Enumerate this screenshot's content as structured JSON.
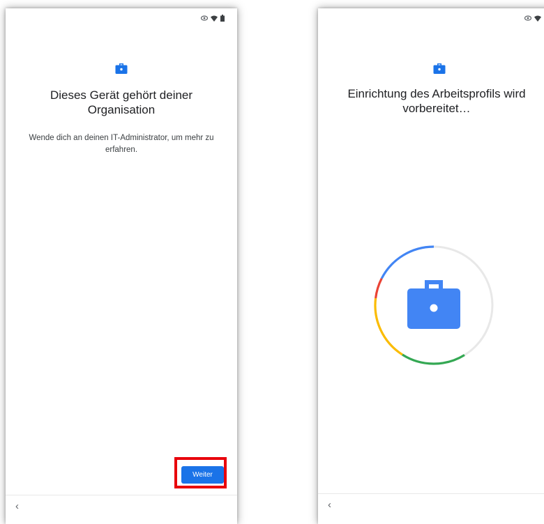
{
  "screens": [
    {
      "title": "Dieses Gerät gehört deiner Organisation",
      "description": "Wende dich an deinen IT-Administrator, um mehr zu erfahren.",
      "continue_button": "Weiter",
      "back_glyph": "‹",
      "icons": [
        "briefcase-icon",
        "eye-icon",
        "wifi-icon",
        "battery-icon"
      ]
    },
    {
      "title": "Einrichtung des Arbeitsprofils wird vorbereitet…",
      "back_glyph": "‹",
      "progress_colors": [
        "#4285f4",
        "#ea4335",
        "#fbbc04",
        "#34a853"
      ],
      "icons": [
        "briefcase-icon",
        "progress-ring",
        "eye-icon",
        "wifi-icon",
        "battery-icon"
      ]
    }
  ],
  "colors": {
    "accent": "#1a73e8",
    "highlight": "#e8000b",
    "work_icon": "#1a73e8",
    "work_icon_large": "#4285f4"
  }
}
